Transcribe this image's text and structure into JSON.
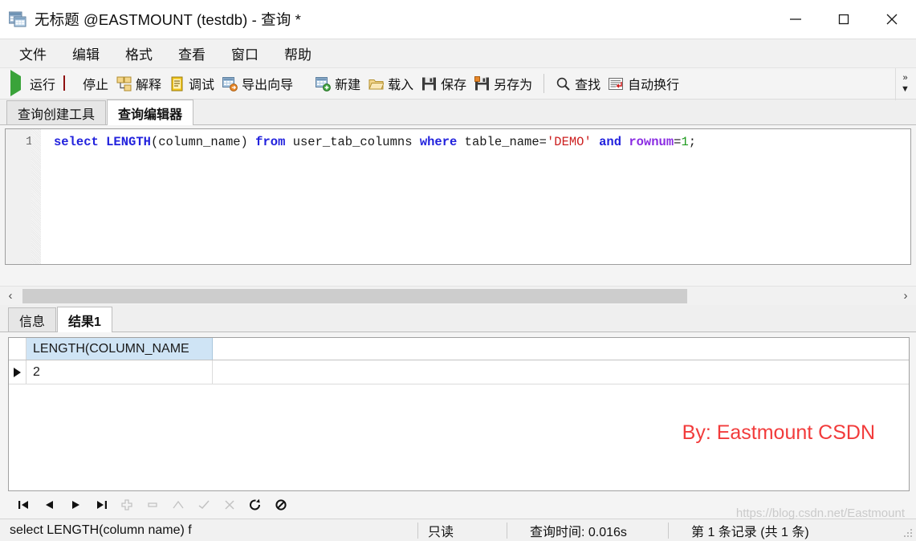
{
  "window": {
    "title": "无标题 @EASTMOUNT (testdb) - 查询 *",
    "icon": "query-window-icon",
    "controls": {
      "minimize": "minimize-icon",
      "maximize": "maximize-icon",
      "close": "close-icon"
    }
  },
  "menubar": {
    "items": [
      {
        "label": "文件"
      },
      {
        "label": "编辑"
      },
      {
        "label": "格式"
      },
      {
        "label": "查看"
      },
      {
        "label": "窗口"
      },
      {
        "label": "帮助"
      }
    ]
  },
  "toolbar": {
    "left_group": [
      {
        "label": "运行",
        "icon": "play-icon"
      },
      {
        "label": "停止",
        "icon": "stop-icon"
      },
      {
        "label": "解释",
        "icon": "explain-icon"
      },
      {
        "label": "调试",
        "icon": "debug-icon"
      },
      {
        "label": "导出向导",
        "icon": "export-wizard-icon"
      }
    ],
    "right_group": [
      {
        "label": "新建",
        "icon": "new-icon"
      },
      {
        "label": "载入",
        "icon": "open-folder-icon"
      },
      {
        "label": "保存",
        "icon": "save-icon"
      },
      {
        "label": "另存为",
        "icon": "save-as-icon"
      }
    ],
    "find_group": [
      {
        "label": "查找",
        "icon": "search-icon"
      },
      {
        "label": "自动换行",
        "icon": "word-wrap-icon"
      }
    ],
    "overflow": "»",
    "overflow_arrow": "▼"
  },
  "editor_tabs": [
    {
      "label": "查询创建工具",
      "active": false
    },
    {
      "label": "查询编辑器",
      "active": true
    }
  ],
  "editor": {
    "line_number": "1",
    "tokens": [
      {
        "text": "select",
        "type": "kw"
      },
      {
        "text": " ",
        "type": "plain"
      },
      {
        "text": "LENGTH",
        "type": "kw"
      },
      {
        "text": "(column_name) ",
        "type": "plain"
      },
      {
        "text": "from",
        "type": "kw"
      },
      {
        "text": " user_tab_columns ",
        "type": "plain"
      },
      {
        "text": "where",
        "type": "kw"
      },
      {
        "text": " table_name=",
        "type": "plain"
      },
      {
        "text": "'DEMO'",
        "type": "str"
      },
      {
        "text": " ",
        "type": "plain"
      },
      {
        "text": "and",
        "type": "kw"
      },
      {
        "text": " ",
        "type": "plain"
      },
      {
        "text": "rownum",
        "type": "ident"
      },
      {
        "text": "=",
        "type": "plain"
      },
      {
        "text": "1",
        "type": "num"
      },
      {
        "text": ";",
        "type": "plain"
      }
    ],
    "scrollbar": {
      "left_arrow": "‹",
      "right_arrow": "›",
      "thumb_percent": 76
    }
  },
  "result_tabs": [
    {
      "label": "信息",
      "active": false
    },
    {
      "label": "结果1",
      "active": true
    }
  ],
  "grid": {
    "columns": [
      "LENGTH(COLUMN_NAME"
    ],
    "rows": [
      {
        "indicator": "current-row-icon",
        "cells": [
          "2"
        ]
      }
    ]
  },
  "watermarks": {
    "red": "By: Eastmount CSDN",
    "url": "https://blog.csdn.net/Eastmount"
  },
  "nav_toolbar": [
    {
      "icon": "first-record-icon",
      "enabled": true
    },
    {
      "icon": "previous-record-icon",
      "enabled": true
    },
    {
      "icon": "next-record-icon",
      "enabled": true
    },
    {
      "icon": "last-record-icon",
      "enabled": true
    },
    {
      "icon": "insert-record-icon",
      "enabled": false
    },
    {
      "icon": "delete-record-icon",
      "enabled": false
    },
    {
      "icon": "edit-record-icon",
      "enabled": false
    },
    {
      "icon": "post-edit-icon",
      "enabled": false
    },
    {
      "icon": "cancel-edit-icon",
      "enabled": false
    },
    {
      "icon": "refresh-icon",
      "enabled": true
    },
    {
      "icon": "stop-query-icon",
      "enabled": true
    }
  ],
  "statusbar": {
    "sql": "select LENGTH(column name) f",
    "readonly": "只读",
    "query_time": "查询时间: 0.016s",
    "record_info": "第 1 条记录 (共 1 条)"
  },
  "colors": {
    "keyword": "#2222dd",
    "string": "#cc2020",
    "identifier": "#8a2be2",
    "number": "#1f9b1f",
    "header_bg": "#cfe4f5",
    "watermark_red": "#f23b3b",
    "run_green": "#3aa33a",
    "stop_red": "#d01919"
  }
}
